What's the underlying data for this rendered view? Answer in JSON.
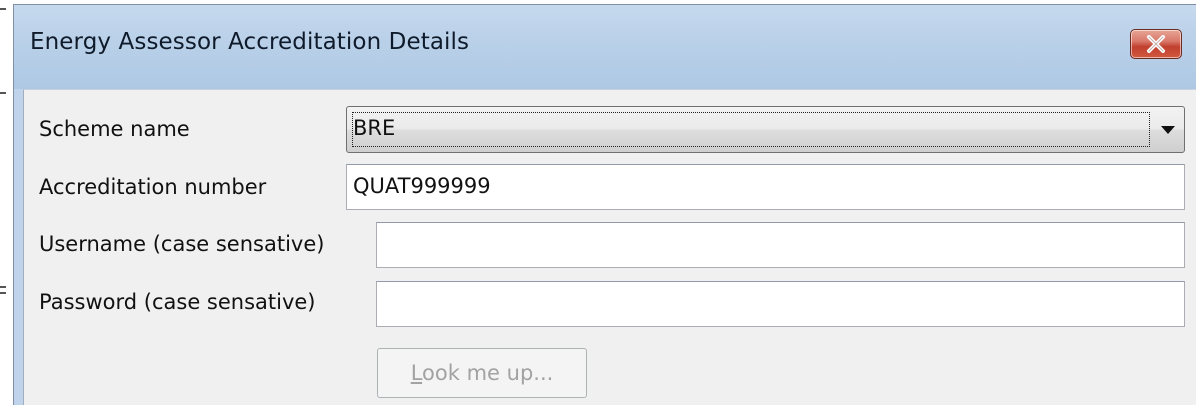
{
  "window": {
    "title": "Energy Assessor Accreditation Details"
  },
  "form": {
    "scheme_label": "Scheme name",
    "scheme_value": "BRE",
    "accreditation_label": "Accreditation number",
    "accreditation_value": "QUAT999999",
    "username_label": "Username (case sensative)",
    "username_value": "",
    "password_label": "Password (case sensative)",
    "password_value": "",
    "lookup_button_label": "Look me up...",
    "lookup_button_enabled": false
  },
  "icons": {
    "close": "close-icon",
    "dropdown": "chevron-down-icon"
  },
  "colors": {
    "titlebar": "#bfd4ea",
    "close_button": "#c1402f",
    "client_background": "#f0f0f0"
  }
}
